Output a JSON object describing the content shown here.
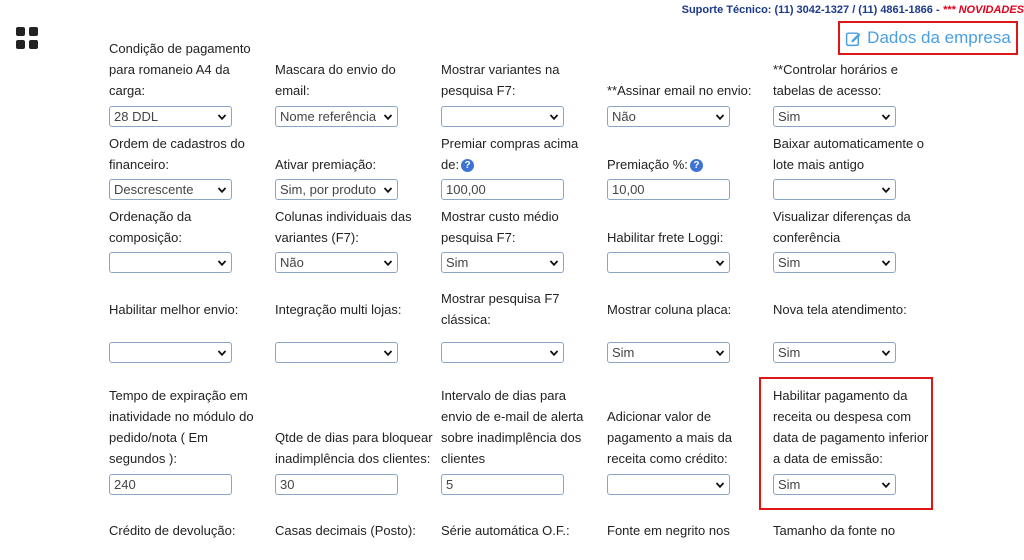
{
  "header": {
    "support_text": "Suporte Técnico: (11) 3042-1327 / (11) 4861-1866 - ",
    "novidades_text": "*** NOVIDADES",
    "company_button_label": "Dados da empresa"
  },
  "colors": {
    "accent": "#4a9fe3",
    "highlight": "#e01515",
    "support": "#1c3a8a"
  },
  "fields": [
    {
      "label": "Condição de pagamento para romaneio A4 da carga:",
      "type": "select",
      "value": "28 DDL"
    },
    {
      "label": "Mascara do envio do email:",
      "type": "select",
      "value": "Nome referência"
    },
    {
      "label": "Mostrar variantes na pesquisa F7:",
      "type": "select",
      "value": ""
    },
    {
      "label": "**Assinar email no envio:",
      "type": "select",
      "value": "Não"
    },
    {
      "label": "**Controlar horários e tabelas de acesso:",
      "type": "select",
      "value": "Sim"
    },
    {
      "label": "Ordem de cadastros do financeiro:",
      "type": "select",
      "value": "Descrescente"
    },
    {
      "label": "Ativar premiação:",
      "type": "select",
      "value": "Sim, por produto"
    },
    {
      "label": "Premiar compras acima de:",
      "type": "input",
      "value": "100,00",
      "help": "?"
    },
    {
      "label": "Premiação %:",
      "type": "input",
      "value": "10,00",
      "help": "?"
    },
    {
      "label": "Baixar automaticamente o lote mais antigo",
      "type": "select",
      "value": ""
    },
    {
      "label": "Ordenação da composição:",
      "type": "select",
      "value": ""
    },
    {
      "label": "Colunas individuais das variantes (F7):",
      "type": "select",
      "value": "Não"
    },
    {
      "label": "Mostrar custo médio pesquisa F7:",
      "type": "select",
      "value": "Sim"
    },
    {
      "label": "Habilitar frete Loggi:",
      "type": "select",
      "value": ""
    },
    {
      "label": "Visualizar diferenças da conferência",
      "type": "select",
      "value": "Sim"
    },
    {
      "label": "Habilitar melhor envio:",
      "type": "select",
      "value": ""
    },
    {
      "label": "Integração multi lojas:",
      "type": "select",
      "value": ""
    },
    {
      "label": "Mostrar pesquisa F7 clássica:",
      "type": "select",
      "value": ""
    },
    {
      "label": "Mostrar coluna placa:",
      "type": "select",
      "value": "Sim"
    },
    {
      "label": "Nova tela atendimento:",
      "type": "select",
      "value": "Sim"
    },
    {
      "label": "Tempo de expiração em inatividade no módulo do pedido/nota ( Em segundos ):",
      "type": "input",
      "value": "240"
    },
    {
      "label": "Qtde de dias para bloquear inadimplência dos clientes:",
      "type": "input",
      "value": "30"
    },
    {
      "label": "Intervalo de dias para envio de e-mail de alerta sobre inadimplência dos clientes",
      "type": "input",
      "value": "5"
    },
    {
      "label": "Adicionar valor de pagamento a mais da receita como crédito:",
      "type": "select",
      "value": ""
    },
    {
      "label": "Habilitar pagamento da receita ou despesa com data de pagamento inferior a data de emissão:",
      "type": "select",
      "value": "Sim"
    },
    {
      "label": "Crédito de devolução:",
      "type": "none",
      "value": ""
    },
    {
      "label": "Casas decimais (Posto):",
      "type": "none",
      "value": ""
    },
    {
      "label": "Série automática O.F.:",
      "type": "none",
      "value": ""
    },
    {
      "label": "Fonte em negrito nos",
      "type": "none",
      "value": ""
    },
    {
      "label": "Tamanho da fonte no",
      "type": "none",
      "value": ""
    }
  ]
}
